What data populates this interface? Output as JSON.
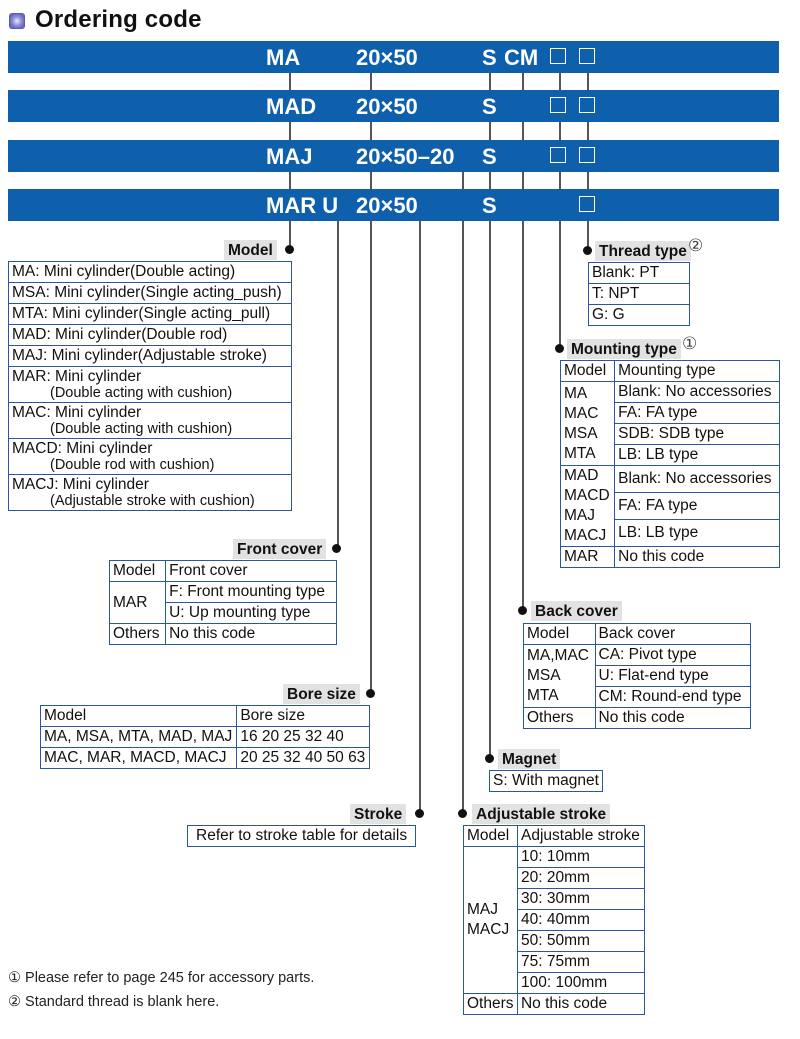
{
  "header": {
    "title": "Ordering code",
    "icon": "square-bullet-icon"
  },
  "code_rows": [
    {
      "model": "MA",
      "bore_stroke": "20×50",
      "magnet": "S",
      "back_cover": "CM",
      "mounting_box": "□",
      "thread_box": "□"
    },
    {
      "model": "MAD",
      "bore_stroke": "20×50",
      "magnet": "S",
      "back_cover": "",
      "mounting_box": "□",
      "thread_box": "□"
    },
    {
      "model": "MAJ",
      "bore_stroke": "20×50–20",
      "magnet": "S",
      "back_cover": "",
      "mounting_box": "□",
      "thread_box": "□"
    },
    {
      "model": "MAR U",
      "bore_stroke": "20×50",
      "magnet": "S",
      "back_cover": "",
      "mounting_box": "",
      "thread_box": "□"
    }
  ],
  "model": {
    "label": "Model",
    "rows": [
      {
        "line1": "MA: Mini cylinder(Double acting)"
      },
      {
        "line1": "MSA: Mini cylinder(Single acting_push)"
      },
      {
        "line1": "MTA: Mini cylinder(Single acting_pull)"
      },
      {
        "line1": "MAD: Mini cylinder(Double rod)"
      },
      {
        "line1": "MAJ: Mini cylinder(Adjustable stroke)"
      },
      {
        "line1": "MAR: Mini cylinder",
        "line2": "(Double acting with cushion)"
      },
      {
        "line1": "MAC: Mini cylinder",
        "line2": "(Double acting with cushion)"
      },
      {
        "line1": "MACD: Mini cylinder",
        "line2": "(Double rod with cushion)"
      },
      {
        "line1": "MACJ: Mini cylinder",
        "line2": "(Adjustable stroke with cushion)"
      }
    ]
  },
  "thread_type": {
    "label": "Thread type",
    "note_mark": "②",
    "rows": [
      "Blank: PT",
      "T: NPT",
      "G: G"
    ]
  },
  "mounting_type": {
    "label": "Mounting type",
    "note_mark": "①",
    "header": [
      "Model",
      "Mounting type"
    ],
    "groups": [
      {
        "models": [
          "MA",
          "MAC",
          "MSA",
          "MTA"
        ],
        "options": [
          "Blank: No accessories",
          "FA: FA type",
          "SDB: SDB type",
          "LB: LB type"
        ]
      },
      {
        "models": [
          "MAD",
          "MACD",
          "MAJ",
          "MACJ"
        ],
        "options": [
          "Blank: No accessories",
          "FA: FA type",
          "LB: LB type"
        ]
      },
      {
        "models": [
          "MAR"
        ],
        "options": [
          "No this code"
        ]
      }
    ]
  },
  "front_cover": {
    "label": "Front cover",
    "header": [
      "Model",
      "Front cover"
    ],
    "groups": [
      {
        "model": "MAR",
        "options": [
          "F: Front mounting type",
          "U: Up mounting type"
        ]
      },
      {
        "model": "Others",
        "options": [
          "No this code"
        ]
      }
    ]
  },
  "back_cover": {
    "label": "Back cover",
    "header": [
      "Model",
      "Back cover"
    ],
    "groups": [
      {
        "models": [
          "MA,MAC",
          "MSA",
          "MTA"
        ],
        "options": [
          "CA: Pivot type",
          "U: Flat-end type",
          "CM: Round-end type"
        ]
      },
      {
        "models": [
          "Others"
        ],
        "options": [
          "No this code"
        ]
      }
    ]
  },
  "bore_size": {
    "label": "Bore size",
    "header": [
      "Model",
      "Bore size"
    ],
    "rows": [
      [
        "MA, MSA, MTA, MAD, MAJ",
        "16 20 25 32 40"
      ],
      [
        "MAC, MAR, MACD, MACJ",
        "20 25 32 40 50 63"
      ]
    ]
  },
  "magnet": {
    "label": "Magnet",
    "rows": [
      "S: With magnet"
    ]
  },
  "stroke": {
    "label": "Stroke",
    "rows": [
      "Refer to stroke table for details"
    ]
  },
  "adjustable_stroke": {
    "label": "Adjustable stroke",
    "header": [
      "Model",
      "Adjustable stroke"
    ],
    "groups": [
      {
        "models": [
          "MAJ",
          "MACJ"
        ],
        "options": [
          "10: 10mm",
          "20: 20mm",
          "30: 30mm",
          "40: 40mm",
          "50: 50mm",
          "75: 75mm",
          "100: 100mm"
        ]
      },
      {
        "models": [
          "Others"
        ],
        "options": [
          "No this code"
        ]
      }
    ]
  },
  "notes": [
    "① Please refer to page 245 for accessory parts.",
    "② Standard thread is blank here."
  ],
  "colors": {
    "bar": "#0e5fac",
    "table_border": "#2a55a0",
    "label_bg": "#e2e2e2"
  }
}
